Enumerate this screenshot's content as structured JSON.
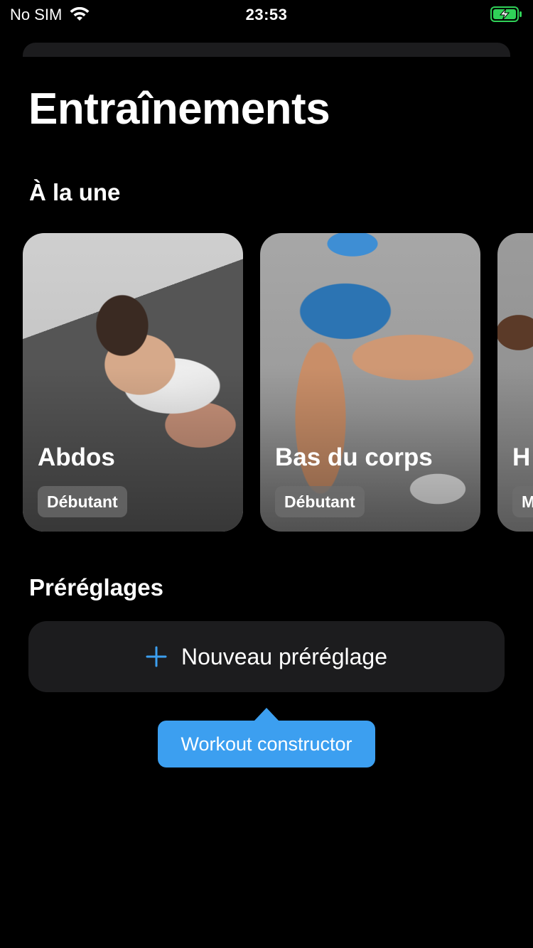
{
  "status_bar": {
    "carrier": "No SIM",
    "time": "23:53",
    "wifi_icon": "wifi-icon",
    "battery_icon": "battery-charging-icon",
    "battery_color": "#30d158"
  },
  "header": {
    "title": "Entraînements"
  },
  "featured": {
    "title": "À la une",
    "cards": [
      {
        "title": "Abdos",
        "level": "Débutant"
      },
      {
        "title": "Bas du corps",
        "level": "Débutant"
      },
      {
        "title": "H",
        "level": "M"
      }
    ]
  },
  "presets": {
    "title": "Préréglages",
    "new_button_label": "Nouveau préréglage",
    "new_button_icon": "plus-icon",
    "accent_color": "#3c9ff0"
  },
  "tooltip": {
    "label": "Workout constructor"
  }
}
